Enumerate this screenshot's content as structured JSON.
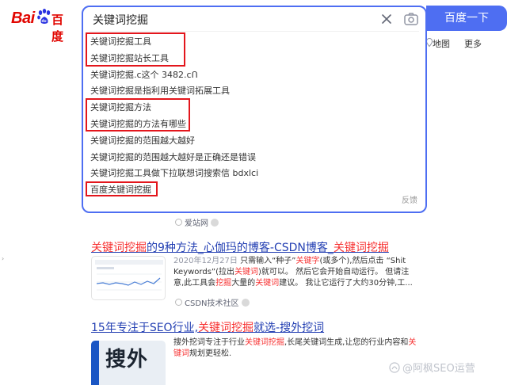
{
  "logo": {
    "latin": "Bai",
    "cjk": "百度"
  },
  "search": {
    "query": "关键词挖掘",
    "button_label": "百度一下",
    "suggestions": [
      "关键词挖掘工具",
      "关键词挖掘站长工具",
      "关键词挖掘.c这个 3482.cՈ",
      "关键词挖掘是指利用关键词拓展工具",
      "关键词挖掘方法",
      "关键词挖掘的方法有哪些",
      "关键词挖掘的范围越大越好",
      "关键词挖掘的范围越大越好是正确还是错误",
      "关键词挖掘工具做下拉联想词搜索信 bdxlci",
      "百度关键词挖掘"
    ],
    "feedback_label": "反馈"
  },
  "nav_extra": {
    "map": "地图",
    "more": "更多"
  },
  "left_mark": "›",
  "results": [
    {
      "source": "爱站网"
    },
    {
      "title_em": "关键词挖掘",
      "title_rest_1": "的9种方法_心伽玛的博客-CSDN博客_",
      "title_em_2": "关键词挖掘",
      "date": "2020年12月27日",
      "abstract_parts": [
        " 只需输入“种子”",
        "关键字",
        "(或多个),然后点击 “Shit Keywords”(拉出",
        "关键词",
        ")就可以。 然后它会开始自动运行。 但请注意,此工具会",
        "挖掘",
        "大量的",
        "关键词",
        "建议。 我让它运行了大约30分钟,工..."
      ],
      "source": "CSDN技术社区"
    },
    {
      "title_rest_1": "15年专注于SEO行业,",
      "title_em": "关键词挖掘",
      "title_rest_2": "就选-搜外挖词",
      "thumb_text": "搜外",
      "abstract_parts": [
        "搜外挖词专注于行业",
        "关键词挖掘",
        ",长尾关键词生成,让您的行业内容和",
        "关键词",
        "规划更轻松."
      ]
    }
  ],
  "watermark": "@阿枫SEO运营",
  "colors": {
    "brand_blue": "#4e6ef2",
    "brand_red": "#e10601",
    "link_blue": "#2440b3",
    "highlight_red": "#f73131",
    "annotation_red": "#e3161c"
  }
}
